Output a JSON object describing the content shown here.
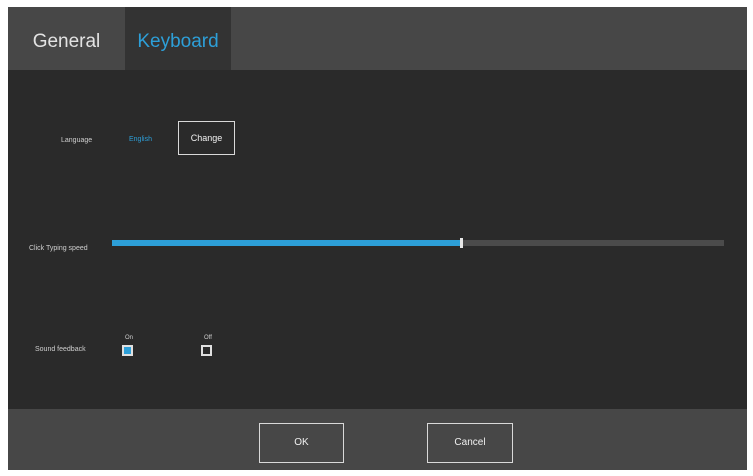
{
  "tabs": [
    {
      "label": "General",
      "selected": false
    },
    {
      "label": "Keyboard",
      "selected": true
    }
  ],
  "language": {
    "label": "Language",
    "value": "English",
    "change_label": "Change"
  },
  "typing_speed": {
    "label": "Click Typing speed",
    "value_fraction": 0.57
  },
  "sound_feedback": {
    "label": "Sound feedback",
    "on_label": "On",
    "off_label": "Off",
    "selected": "On"
  },
  "footer": {
    "ok_label": "OK",
    "cancel_label": "Cancel"
  },
  "colors": {
    "accent": "#2d9fd8",
    "panel_bg": "#2a2a2a",
    "bar_bg": "#474747"
  }
}
